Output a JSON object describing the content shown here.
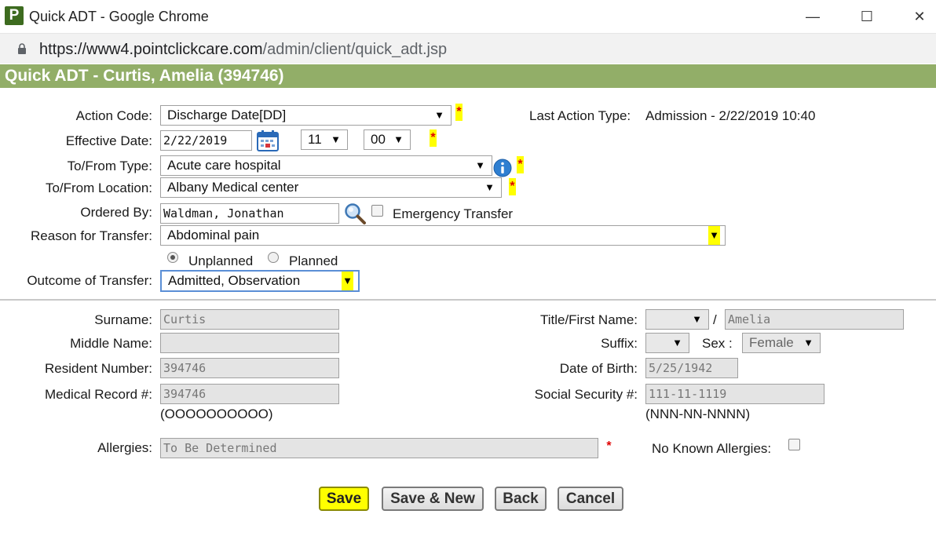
{
  "window": {
    "logo_letter": "P",
    "title": "Quick ADT - Google Chrome",
    "minimize": "—",
    "maximize": "☐",
    "close": "✕"
  },
  "address_bar": {
    "url_host": "https://www4.pointclickcare.com",
    "url_path": "/admin/client/quick_adt.jsp"
  },
  "header": {
    "title": "Quick ADT - Curtis, Amelia (394746)"
  },
  "transfer_form": {
    "action_code_label": "Action Code:",
    "action_code_value": "Discharge Date[DD]",
    "last_action_label": "Last Action Type:",
    "last_action_value": "Admission",
    "last_action_separator": " - ",
    "last_action_datetime": "2/22/2019 10:40",
    "effective_date_label": "Effective Date:",
    "effective_date_value": "2/22/2019",
    "hour_value": "11",
    "minute_value": "00",
    "to_from_type_label": "To/From Type:",
    "to_from_type_value": "Acute care hospital",
    "to_from_location_label": "To/From Location:",
    "to_from_location_value": "Albany Medical center",
    "ordered_by_label": "Ordered By:",
    "ordered_by_value": "Waldman, Jonathan",
    "emergency_transfer_label": "Emergency Transfer",
    "reason_label": "Reason for Transfer:",
    "reason_value": "Abdominal pain",
    "unplanned_label": "Unplanned",
    "planned_label": "Planned",
    "outcome_label": "Outcome of Transfer:",
    "outcome_value": "Admitted, Observation",
    "required_mark": "*",
    "arrow": "▼"
  },
  "resident_form": {
    "surname_label": "Surname:",
    "surname_value": "Curtis",
    "middle_name_label": "Middle Name:",
    "middle_name_value": "",
    "resident_number_label": "Resident Number:",
    "resident_number_value": "394746",
    "medical_record_label": "Medical Record #:",
    "medical_record_value": "394746",
    "medical_record_hint": "(OOOOOOOOOO)",
    "title_first_name_label": "Title/First Name:",
    "title_value": "",
    "slash": "/",
    "first_name_value": "Amelia",
    "suffix_label": "Suffix:",
    "suffix_value": "",
    "sex_label": "Sex :",
    "sex_value": "Female",
    "dob_label": "Date of Birth:",
    "dob_value": "5/25/1942",
    "ssn_label": "Social Security #:",
    "ssn_value": "111-11-1119",
    "ssn_hint": "(NNN-NN-NNNN)",
    "allergies_label": "Allergies:",
    "allergies_value": "To Be Determined",
    "no_known_allergies_label": "No Known Allergies:"
  },
  "actions": {
    "save": "Save",
    "save_new": "Save & New",
    "back": "Back",
    "cancel": "Cancel"
  },
  "colors": {
    "banner": "#92ae68",
    "required_highlight": "#ffff00",
    "required_star": "#e00000",
    "save_button": "#ffff00"
  }
}
